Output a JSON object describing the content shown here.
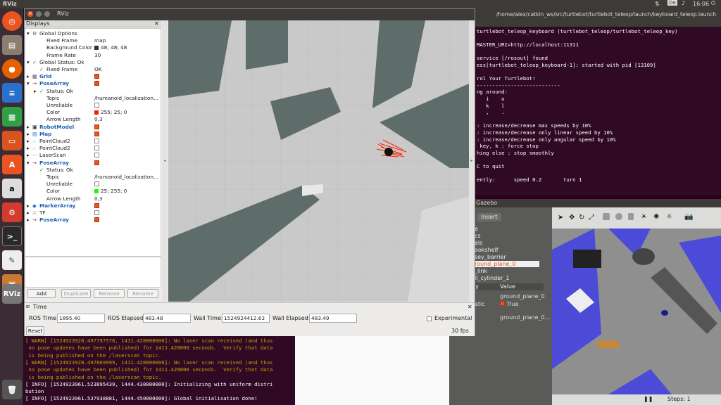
{
  "topbar": {
    "app": "RViz",
    "lang": "De",
    "time": "16:06"
  },
  "launcher": {
    "items": [
      "ubuntu-logo-icon",
      "files-icon",
      "firefox-icon",
      "writer-icon",
      "calc-icon",
      "impress-icon",
      "software-center-icon",
      "amazon-icon",
      "settings-icon",
      "terminal-icon",
      "text-editor-icon",
      "installer-icon",
      "rviz-icon",
      "trash-icon"
    ]
  },
  "terminal": {
    "title": "/home/alex/catkin_ws/src/turtlebot/turtlebot_teleop/launch/keyboard_teleop.launch",
    "lines": [
      "turtlebot_teleop_keyboard (turtlebot_teleop/turtlebot_teleop_key)",
      "",
      "MASTER_URI=http://localhost:11311",
      "",
      "service [/rosout] found",
      "ess[turtlebot_teleop_keyboard-1]: started with pid [13109]",
      "",
      "rol Your Turtlebot!",
      "---------------------------",
      "ng around:",
      "   i    o",
      "   k    l",
      "   ,    .",
      "",
      ": increase/decrease max speeds by 10%",
      ": increase/decrease only linear speed by 10%",
      ": increase/decrease only angular speed by 10%",
      " key, k : force stop",
      "hing else : stop smoothly",
      "",
      "C to quit",
      "",
      "ently:      speed 0.2       turn 1"
    ]
  },
  "bottom_terminal": {
    "lines": [
      {
        "t": "[ WARN] [1524923928.497797570, 1411.420000000]: No laser scan received (and thus",
        "c": "#c4a000"
      },
      {
        "t": " no pose updates have been published) for 1411.420000 seconds.  Verify that data",
        "c": "#c4a000"
      },
      {
        "t": " is being published on the /laserscan topic.",
        "c": "#c4a000"
      },
      {
        "t": "[ WARN] [1524923928.497869999, 1411.420000000]: No laser scan received (and thus",
        "c": "#c4a000"
      },
      {
        "t": " no pose updates have been published) for 1411.420000 seconds.  Verify that data",
        "c": "#c4a000"
      },
      {
        "t": " is being published on the /laserscan topic.",
        "c": "#c4a000"
      },
      {
        "t": "[ INFO] [1524923961.523895439, 1444.430000000]: Initializing with uniform distri",
        "c": "#ffffff"
      },
      {
        "t": "bution",
        "c": "#ffffff"
      },
      {
        "t": "[ INFO] [1524923961.537938881, 1444.450000000]: Global initialisation done!",
        "c": "#ffffff"
      }
    ]
  },
  "gazebo": {
    "title": "Gazebo",
    "tab_insert": "Insert",
    "tree": [
      "e",
      "cs",
      "els",
      "ookshelf",
      "sey_barrier",
      "round_plane_0",
      "_link",
      "ll_cylinder_1"
    ],
    "prop_header": [
      "ty",
      "Value"
    ],
    "props": [
      [
        "",
        "ground_plane_0"
      ],
      [
        "atic",
        "True"
      ],
      [
        "",
        "ground_plane_0..."
      ]
    ],
    "steps": "Steps: 1"
  },
  "rviz": {
    "title": "RViz",
    "displays_title": "Displays",
    "tree": [
      {
        "label": "Global Options",
        "value": "",
        "indent": 0,
        "icon": "gear-icon",
        "check": ""
      },
      {
        "label": "Fixed Frame",
        "value": "map",
        "indent": 1,
        "icon": "",
        "check": ""
      },
      {
        "label": "Background Color",
        "value": "48; 48; 48",
        "indent": 1,
        "icon": "",
        "check": "",
        "swatch": "#303030"
      },
      {
        "label": "Frame Rate",
        "value": "30",
        "indent": 1,
        "icon": "",
        "check": ""
      },
      {
        "label": "Global Status: Ok",
        "value": "",
        "indent": 0,
        "icon": "check-icon",
        "check": ""
      },
      {
        "label": "Fixed Frame",
        "value": "OK",
        "indent": 1,
        "icon": "check-icon",
        "check": ""
      },
      {
        "label": "Grid",
        "value": "",
        "indent": 0,
        "icon": "grid-icon",
        "check": "on",
        "blue": true
      },
      {
        "label": "PoseArray",
        "value": "",
        "indent": 0,
        "icon": "posearray-icon",
        "check": "on",
        "blue": true
      },
      {
        "label": "Status: Ok",
        "value": "",
        "indent": 1,
        "icon": "check-icon",
        "check": ""
      },
      {
        "label": "Topic",
        "value": "/humanoid_localization...",
        "indent": 1,
        "icon": "",
        "check": ""
      },
      {
        "label": "Unreliable",
        "value": "",
        "indent": 1,
        "icon": "",
        "check": "off"
      },
      {
        "label": "Color",
        "value": "255; 25; 0",
        "indent": 1,
        "icon": "",
        "check": "",
        "swatch": "#ff1900"
      },
      {
        "label": "Arrow Length",
        "value": "0,3",
        "indent": 1,
        "icon": "",
        "check": ""
      },
      {
        "label": "RobotModel",
        "value": "",
        "indent": 0,
        "icon": "robot-icon",
        "check": "on",
        "blue": true
      },
      {
        "label": "Map",
        "value": "",
        "indent": 0,
        "icon": "map-icon",
        "check": "on",
        "blue": true
      },
      {
        "label": "PointCloud2",
        "value": "",
        "indent": 0,
        "icon": "pointcloud-icon",
        "check": "off"
      },
      {
        "label": "PointCloud2",
        "value": "",
        "indent": 0,
        "icon": "pointcloud-icon",
        "check": "off"
      },
      {
        "label": "LaserScan",
        "value": "",
        "indent": 0,
        "icon": "laser-icon",
        "check": "off"
      },
      {
        "label": "PoseArray",
        "value": "",
        "indent": 0,
        "icon": "posearray-icon",
        "check": "on",
        "blue": true
      },
      {
        "label": "Status: Ok",
        "value": "",
        "indent": 1,
        "icon": "check-icon",
        "check": ""
      },
      {
        "label": "Topic",
        "value": "/humanoid_localization...",
        "indent": 1,
        "icon": "",
        "check": ""
      },
      {
        "label": "Unreliable",
        "value": "",
        "indent": 1,
        "icon": "",
        "check": "off"
      },
      {
        "label": "Color",
        "value": "25; 255; 0",
        "indent": 1,
        "icon": "",
        "check": "",
        "swatch": "#19ff00"
      },
      {
        "label": "Arrow Length",
        "value": "0,3",
        "indent": 1,
        "icon": "",
        "check": ""
      },
      {
        "label": "MarkerArray",
        "value": "",
        "indent": 0,
        "icon": "marker-icon",
        "check": "on",
        "blue": true
      },
      {
        "label": "TF",
        "value": "",
        "indent": 0,
        "icon": "tf-icon",
        "check": "off"
      },
      {
        "label": "PoseArray",
        "value": "",
        "indent": 0,
        "icon": "posearray-icon",
        "check": "on",
        "blue": true
      }
    ],
    "buttons": {
      "add": "Add",
      "duplicate": "Duplicate",
      "remove": "Remove",
      "rename": "Rename"
    },
    "time_panel": {
      "title": "Time",
      "ros_time_label": "ROS Time:",
      "ros_time": "1895.40",
      "ros_elapsed_label": "ROS Elapsed:",
      "ros_elapsed": "483.48",
      "wall_time_label": "Wall Time:",
      "wall_time": "1524924412.63",
      "wall_elapsed_label": "Wall Elapsed:",
      "wall_elapsed": "483.49",
      "experimental": "Experimental",
      "reset": "Reset",
      "fps": "30 fps"
    }
  }
}
